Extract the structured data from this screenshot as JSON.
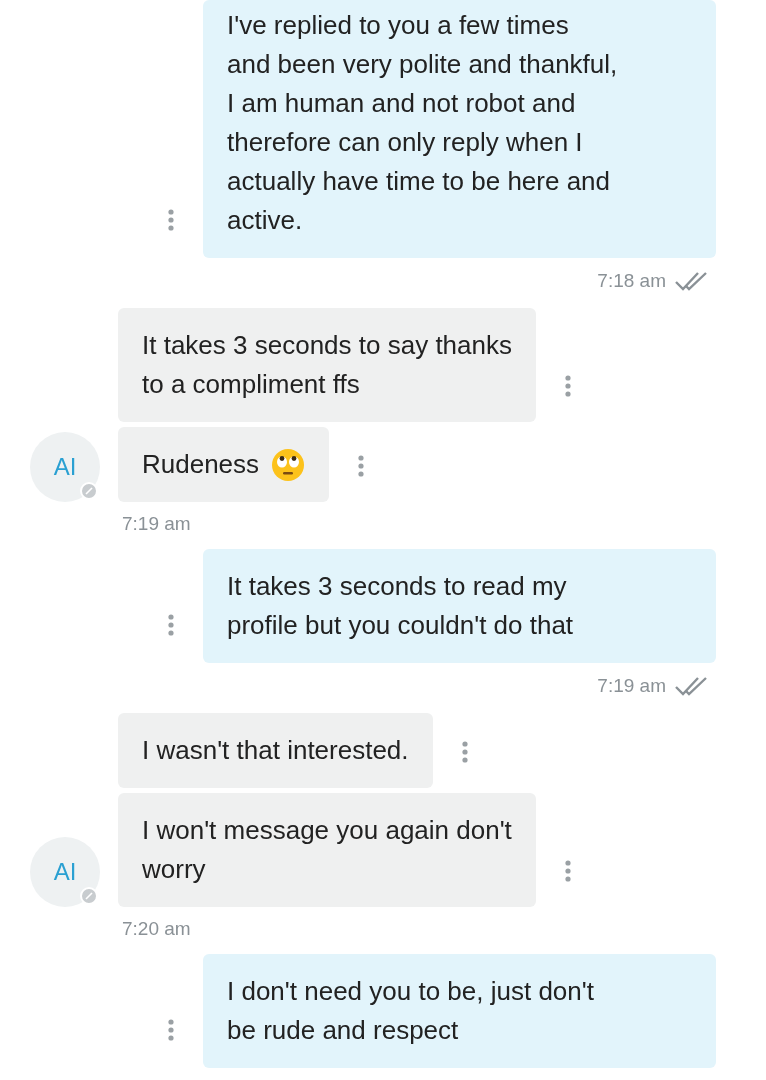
{
  "messages": [
    {
      "kind": "outgoing",
      "lines": [
        "I've replied to you a few times",
        "and been very polite and thankful,",
        "I am human and not robot and",
        "therefore can only reply when I",
        "actually have time to be here and",
        "active."
      ]
    },
    {
      "kind": "receipt",
      "time": "7:18 am",
      "read": true
    },
    {
      "kind": "incoming",
      "lines": [
        "It takes 3 seconds to say thanks",
        "to a compliment ffs"
      ]
    },
    {
      "kind": "incoming",
      "lines": [
        "Rudeness"
      ],
      "emoji": true,
      "avatar": "AI"
    },
    {
      "kind": "stamp",
      "time": "7:19 am"
    },
    {
      "kind": "outgoing",
      "lines": [
        "It takes 3 seconds to read my",
        "profile but you couldn't do that"
      ]
    },
    {
      "kind": "receipt",
      "time": "7:19 am",
      "read": true
    },
    {
      "kind": "incoming",
      "lines": [
        "I wasn't that interested."
      ]
    },
    {
      "kind": "incoming",
      "lines": [
        "I won't message you again don't",
        "worry"
      ],
      "avatar": "AI"
    },
    {
      "kind": "stamp",
      "time": "7:20 am"
    },
    {
      "kind": "outgoing",
      "lines": [
        "I don't need you to be, just don't",
        "be rude and respect"
      ]
    }
  ]
}
